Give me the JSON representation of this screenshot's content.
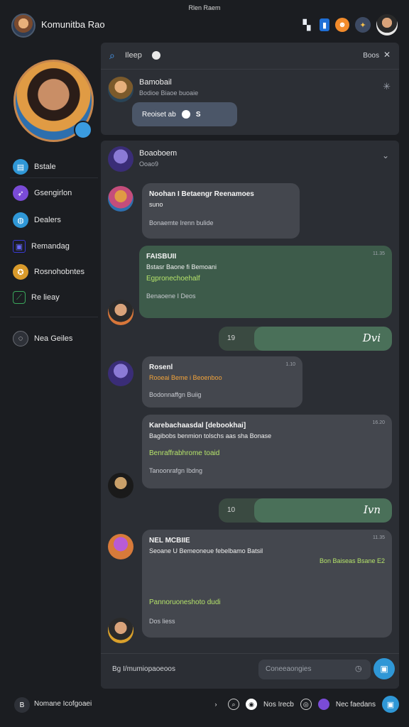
{
  "status_bar": {
    "text": "Rlen Raem"
  },
  "header": {
    "app_title": "Komunitba Rao"
  },
  "sidebar": {
    "items": [
      {
        "label": "Bstale",
        "icon": "document-icon",
        "color": "#2f97d6"
      },
      {
        "label": "Gsengirlon",
        "icon": "rocket-icon",
        "color": "#7a4bd6"
      },
      {
        "label": "Dealers",
        "icon": "group-icon",
        "color": "#2f97d6"
      },
      {
        "label": "Remandag",
        "icon": "folder-icon",
        "color": "#3a3ad6"
      },
      {
        "label": "Rosnohobntes",
        "icon": "badge-icon",
        "color": "#d99a2b"
      },
      {
        "label": "Re lieay",
        "icon": "leaf-icon",
        "color": "#3aa65b"
      },
      {
        "label": "Nea Geiles",
        "icon": "chat-icon",
        "color": "#6a6d74"
      }
    ]
  },
  "search": {
    "placeholder": "Ileep",
    "right_label": "Boos"
  },
  "pinned": {
    "name": "Bamobail",
    "subtitle": "Bodioe Biaoe buoaie",
    "chip_label": "Reoiset ab"
  },
  "chat": {
    "header_name": "Boaoboem",
    "header_sub": "Ooao9",
    "messages": [
      {
        "title": "Noohan I Betaengr Reenamoes",
        "line": "suno",
        "foot": "Bonaemte Irenn bulide"
      },
      {
        "title": "FAISBUII",
        "line": "Bstasr Baone fi Bemoani",
        "accent": "Egpronechoehalf",
        "foot": "Benaoene I Deos",
        "time": "11.35"
      },
      {
        "title": "Rosenl",
        "line": "Rooeai Beme i Beoenboo",
        "foot": "Bodonnaffgn Buiig",
        "time": "1.10"
      },
      {
        "title": "Karebachaasdal [debookhai]",
        "line": "Bagibobs benmion tolschs aas sha Bonase",
        "accent": "Benraffrabhrome toaid",
        "foot": "Tanoonrafgn Ibdng",
        "time": "16.20"
      },
      {
        "title": "NEL MCBIIE",
        "line": "Seoane U Bemeoneue febelbamo Batsil",
        "side": "Bon Baiseas Bsane E2",
        "accent": "Pannoruoneshoto dudi",
        "foot": "Dos liess",
        "time": "11.35"
      }
    ],
    "sent": [
      {
        "meta": "19",
        "text": "Dvi"
      },
      {
        "meta": "10",
        "text": "Ivn"
      }
    ]
  },
  "composer": {
    "text": "Bg I/mumiopaoeoos",
    "placeholder": "Coneeaongies"
  },
  "bottom_bar": {
    "badge": "B",
    "text": "Nomane Icofgoaei",
    "right_text_1": "Nos Irecb",
    "right_text_2": "Nec faedans"
  },
  "colors": {
    "background": "#1b1d21",
    "card": "#2b2e34",
    "bubble": "#44474e",
    "green_bubble": "#3d5b4a",
    "accent": "#2f97d6"
  }
}
